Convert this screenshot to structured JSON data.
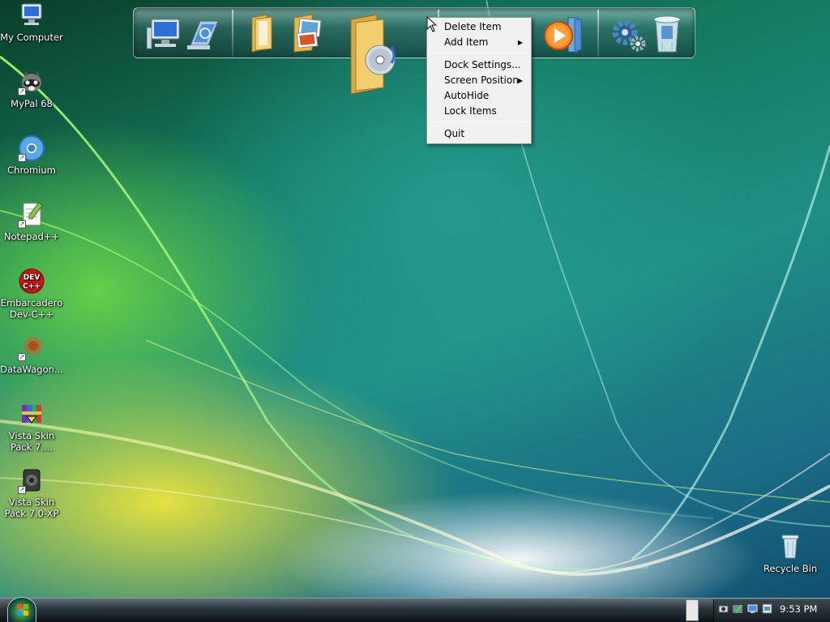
{
  "desktop": {
    "icons": [
      {
        "label": "My Computer"
      },
      {
        "label": "MyPal 68"
      },
      {
        "label": "Chromium"
      },
      {
        "label": "Notepad++"
      },
      {
        "label": "Embarcadero Dev-C++"
      },
      {
        "label": "DataWagon..."
      },
      {
        "label": "Vista Skin Pack 7...."
      },
      {
        "label": "Vista Skin Pack 7.0-XP"
      }
    ],
    "recycle_bin": {
      "label": "Recycle Bin"
    }
  },
  "dock": {
    "items": [
      {
        "icon": "computer-icon"
      },
      {
        "icon": "network-icon"
      },
      {
        "icon": "documents-folder-icon"
      },
      {
        "icon": "pictures-folder-icon"
      },
      {
        "icon": "music-folder-icon"
      },
      {
        "icon": "media-player-icon"
      },
      {
        "icon": "settings-gears-icon"
      },
      {
        "icon": "recycle-bin-icon"
      }
    ]
  },
  "context_menu": {
    "items": [
      {
        "label": "Delete Item",
        "submenu": false
      },
      {
        "label": "Add Item",
        "submenu": true
      },
      {
        "label": "Dock Settings...",
        "submenu": false
      },
      {
        "label": "Screen Position",
        "submenu": true
      },
      {
        "label": "AutoHide",
        "submenu": false
      },
      {
        "label": "Lock Items",
        "submenu": false
      },
      {
        "label": "Quit",
        "submenu": false
      }
    ]
  },
  "taskbar": {
    "clock": "9:53 PM"
  },
  "colors": {
    "menu_bg": "#f0f0f0",
    "taskbar": "#1a2126",
    "dock_glass": "#3c6e6e"
  }
}
